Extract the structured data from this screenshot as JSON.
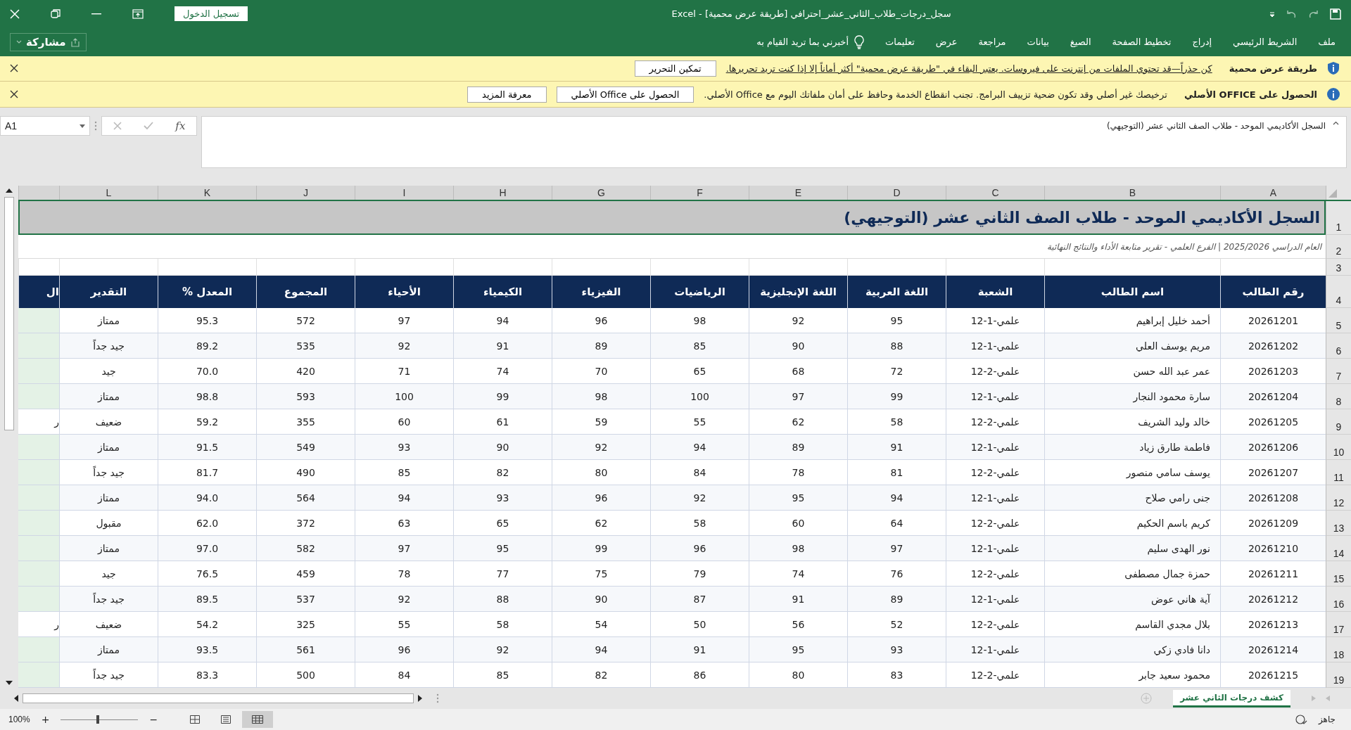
{
  "title_bar": {
    "title": "سجل_درجات_طلاب_الثاني_عشر_احترافي  [طريقة عرض محمية]  -  Excel",
    "sign_in": "تسجيل الدخول"
  },
  "ribbon": {
    "tabs": [
      "ملف",
      "الشريط الرئيسي",
      "إدراج",
      "تخطيط الصفحة",
      "الصيغ",
      "بيانات",
      "مراجعة",
      "عرض",
      "تعليمات"
    ],
    "tell_me": "أخبرني بما تريد القيام به",
    "share": "مشاركة"
  },
  "message_bars": [
    {
      "kind": "shield",
      "title": "طريقة عرض محمية",
      "message": "كن حذراً—قد تحتوي الملفات من إنترنت على فيروسات. يعتبر البقاء في \"طريقة عرض محمية\" أكثر أماناً إلا إذا كنت تريد تحريرها.",
      "link": true,
      "buttons": [
        "تمكين التحرير"
      ]
    },
    {
      "kind": "info",
      "title": "الحصول على OFFICE الأصلي",
      "message": "ترخيصك غير أصلي وقد تكون ضحية تزييف البرامج. تجنب انقطاع الخدمة وحافظ على أمان ملفاتك اليوم مع Office الأصلي.",
      "link": false,
      "buttons": [
        "الحصول على Office الأصلي",
        "معرفة المزيد"
      ]
    }
  ],
  "formula_bar": {
    "name_box": "A1",
    "fx": "fx",
    "content": "السجل الأكاديمي الموحد - طلاب الصف الثاني عشر (التوجيهي)"
  },
  "row_numbers": [
    "1",
    "2",
    "3",
    "4",
    "5",
    "6",
    "7",
    "8",
    "9",
    "10",
    "11",
    "12",
    "13",
    "14",
    "15",
    "16",
    "17",
    "18",
    "19"
  ],
  "column_letters": [
    "A",
    "B",
    "C",
    "D",
    "E",
    "F",
    "G",
    "H",
    "I",
    "J",
    "K",
    "L"
  ],
  "sheet": {
    "title": "السجل الأكاديمي الموحد - طلاب الصف الثاني عشر (التوجيهي)",
    "subtitle": "العام الدراسي 2025/2026 | الفرع العلمي - تقرير متابعة الأداء والنتائج النهائية",
    "headers": [
      "رقم الطالب",
      "اسم الطالب",
      "الشعبة",
      "اللغة العربية",
      "اللغة الإنجليزية",
      "الرياضيات",
      "الفيزياء",
      "الكيمياء",
      "الأحياء",
      "المجموع",
      "المعدل %",
      "التقدير",
      "ال"
    ],
    "rows": [
      {
        "cells": [
          "20261201",
          "أحمد خليل إبراهيم",
          "علمي-1-12",
          "95",
          "92",
          "98",
          "96",
          "94",
          "97",
          "572",
          "95.3",
          "ممتاز"
        ],
        "passed": true
      },
      {
        "cells": [
          "20261202",
          "مريم يوسف العلي",
          "علمي-1-12",
          "88",
          "90",
          "85",
          "89",
          "91",
          "92",
          "535",
          "89.2",
          "جيد جداً"
        ],
        "passed": true
      },
      {
        "cells": [
          "20261203",
          "عمر عبد الله حسن",
          "علمي-2-12",
          "72",
          "68",
          "65",
          "70",
          "74",
          "71",
          "420",
          "70.0",
          "جيد"
        ],
        "passed": true
      },
      {
        "cells": [
          "20261204",
          "سارة محمود النجار",
          "علمي-1-12",
          "99",
          "97",
          "100",
          "98",
          "99",
          "100",
          "593",
          "98.8",
          "ممتاز"
        ],
        "passed": true
      },
      {
        "cells": [
          "20261205",
          "خالد وليد الشريف",
          "علمي-2-12",
          "58",
          "62",
          "55",
          "59",
          "61",
          "60",
          "355",
          "59.2",
          "ضعيف"
        ],
        "passed": false,
        "column_13": "ر"
      },
      {
        "cells": [
          "20261206",
          "فاطمة طارق زياد",
          "علمي-1-12",
          "91",
          "89",
          "94",
          "92",
          "90",
          "93",
          "549",
          "91.5",
          "ممتاز"
        ],
        "passed": true
      },
      {
        "cells": [
          "20261207",
          "يوسف سامي منصور",
          "علمي-2-12",
          "81",
          "78",
          "84",
          "80",
          "82",
          "85",
          "490",
          "81.7",
          "جيد جداً"
        ],
        "passed": true
      },
      {
        "cells": [
          "20261208",
          "جنى رامي صلاح",
          "علمي-1-12",
          "94",
          "95",
          "92",
          "96",
          "93",
          "94",
          "564",
          "94.0",
          "ممتاز"
        ],
        "passed": true
      },
      {
        "cells": [
          "20261209",
          "كريم باسم الحكيم",
          "علمي-2-12",
          "64",
          "60",
          "58",
          "62",
          "65",
          "63",
          "372",
          "62.0",
          "مقبول"
        ],
        "passed": true
      },
      {
        "cells": [
          "20261210",
          "نور الهدى سليم",
          "علمي-1-12",
          "97",
          "98",
          "96",
          "99",
          "95",
          "97",
          "582",
          "97.0",
          "ممتاز"
        ],
        "passed": true
      },
      {
        "cells": [
          "20261211",
          "حمزة جمال مصطفى",
          "علمي-2-12",
          "76",
          "74",
          "79",
          "75",
          "77",
          "78",
          "459",
          "76.5",
          "جيد"
        ],
        "passed": true
      },
      {
        "cells": [
          "20261212",
          "آية هاني عوض",
          "علمي-1-12",
          "89",
          "91",
          "87",
          "90",
          "88",
          "92",
          "537",
          "89.5",
          "جيد جداً"
        ],
        "passed": true
      },
      {
        "cells": [
          "20261213",
          "بلال مجدي القاسم",
          "علمي-2-12",
          "52",
          "56",
          "50",
          "54",
          "58",
          "55",
          "325",
          "54.2",
          "ضعيف"
        ],
        "passed": false,
        "column_13": "ر"
      },
      {
        "cells": [
          "20261214",
          "دانا فادي زكي",
          "علمي-1-12",
          "93",
          "95",
          "91",
          "94",
          "92",
          "96",
          "561",
          "93.5",
          "ممتاز"
        ],
        "passed": true
      },
      {
        "cells": [
          "20261215",
          "محمود سعيد جابر",
          "علمي-2-12",
          "83",
          "80",
          "86",
          "82",
          "85",
          "84",
          "500",
          "83.3",
          "جيد جداً"
        ],
        "passed": true
      }
    ]
  },
  "sheet_tabs": [
    {
      "label": "كشف درجات الثاني عشر",
      "selected": true
    }
  ],
  "status_bar": {
    "status": "جاهز",
    "zoom": "100%",
    "zoom_in": "+",
    "zoom_out": "−",
    "zoom_slider": {
      "level": 0.5
    },
    "views": [
      {
        "kind": "normal",
        "selected": true
      },
      {
        "kind": "page_layout",
        "selected": false
      },
      {
        "kind": "page_break",
        "selected": false
      }
    ]
  }
}
